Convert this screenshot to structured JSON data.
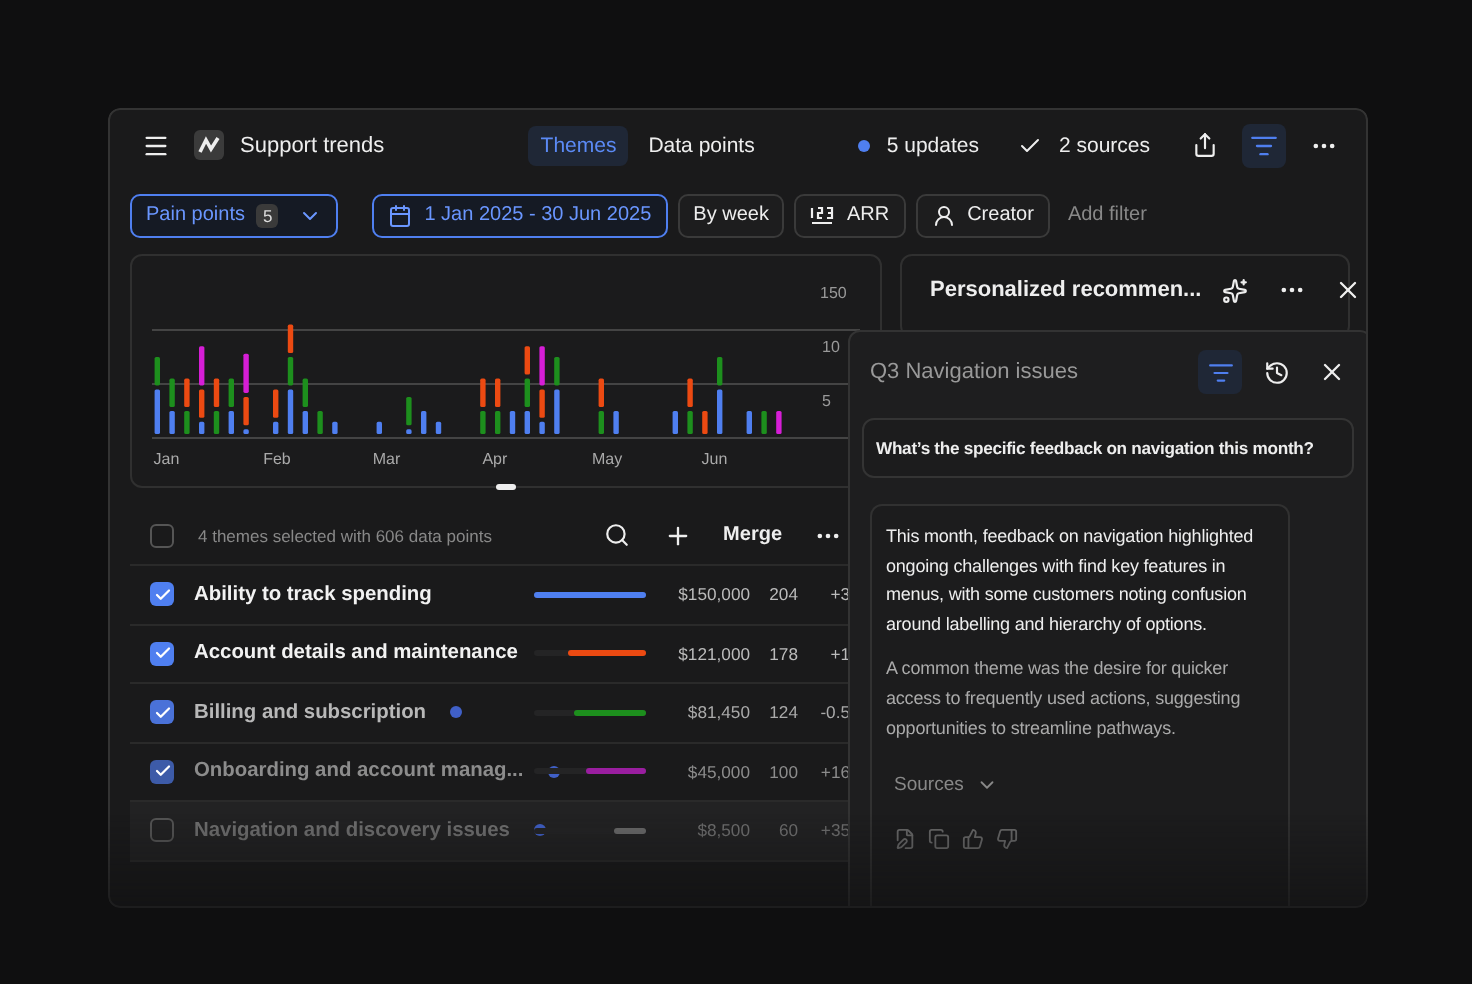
{
  "topbar": {
    "title": "Support trends",
    "tabs": [
      {
        "label": "Themes",
        "selected": true
      },
      {
        "label": "Data points",
        "selected": false
      }
    ],
    "updates": "5 updates",
    "sources": "2 sources",
    "filter_active": true
  },
  "filters": [
    {
      "kind": "dropdown",
      "label": "Pain points",
      "count": "5",
      "selected": true
    },
    {
      "kind": "date",
      "label": "1 Jan 2025 - 30 Jun 2025",
      "selected": true
    },
    {
      "kind": "plain",
      "label": "By week",
      "selected": false
    },
    {
      "kind": "metric",
      "label": "ARR",
      "selected": false
    },
    {
      "kind": "person",
      "label": "Creator",
      "selected": false
    }
  ],
  "add_filter": "Add filter",
  "chart": {
    "y_labels": [
      "150",
      "10",
      "5"
    ],
    "x_labels": [
      "Jan",
      "Feb",
      "Mar",
      "Apr",
      "May",
      "Jun"
    ]
  },
  "table": {
    "summary": "4 themes selected with 606 data points",
    "all_checked": false,
    "merge": "Merge",
    "rows": [
      {
        "name": "Ability to track spending",
        "checked": true,
        "new": false,
        "color": "#4f7ff0",
        "level": 1,
        "amount": "$150,000",
        "count": "204",
        "change": "+3"
      },
      {
        "name": "Account details and maintenance",
        "checked": true,
        "new": false,
        "color": "#ec4a12",
        "level": 0.7,
        "amount": "$121,000",
        "count": "178",
        "change": "+1"
      },
      {
        "name": "Billing and subscription",
        "checked": true,
        "new": true,
        "color": "#1d8f1d",
        "level": 0.64,
        "amount": "$81,450",
        "count": "124",
        "change": "-0.5"
      },
      {
        "name": "Onboarding and account manag...",
        "checked": true,
        "new": true,
        "color": "#9a1ea0",
        "level": 0.54,
        "amount": "$45,000",
        "count": "100",
        "change": "+16"
      },
      {
        "name": "Navigation and discovery issues",
        "checked": false,
        "new": true,
        "color": "#6a6a6a",
        "level": 0.28,
        "amount": "$8,500",
        "count": "60",
        "change": "+35"
      }
    ]
  },
  "recommendation": {
    "title": "Personalized recommen..."
  },
  "panel": {
    "title": "Q3 Navigation issues",
    "filter_active": true,
    "question": "What’s the specific feedback on navigation this month?",
    "answer": [
      "This month, feedback on navigation highlighted ongoing challenges with find key features in menus, with some customers noting confusion around labelling and hierarchy of options.",
      "A common theme was the desire for quicker access to frequently used actions, suggesting opportunities to streamline pathways."
    ],
    "sources": "Sources"
  }
}
